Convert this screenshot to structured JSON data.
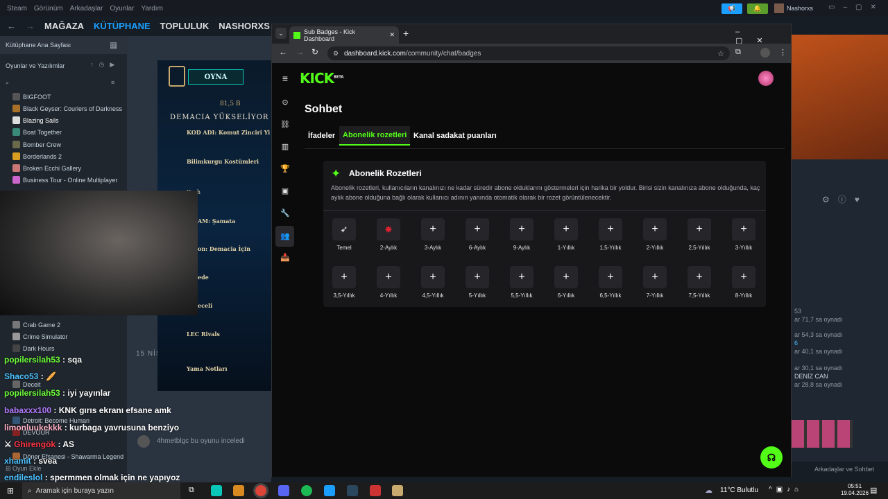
{
  "steam": {
    "menu": [
      "Steam",
      "Görünüm",
      "Arkadaşlar",
      "Oyunlar",
      "Yardım"
    ],
    "nav": [
      "MAĞAZA",
      "KÜTÜPHANE",
      "TOPLULUK",
      "NASHORXS"
    ],
    "username": "Nashorxs",
    "home": "Kütüphane Ana Sayfası",
    "filter": "Oyunlar ve Yazılımlar",
    "games_top": [
      "BIGFOOT",
      "Black Geyser: Couriers of Darkness",
      "Blazing Sails",
      "Boat Together",
      "Bomber Crew",
      "Borderlands 2",
      "Broken Ecchi Gallery",
      "Business Tour - Online Multiplayer"
    ],
    "games_bottom": [
      "Crab Game 2",
      "Crime Simulator",
      "Dark Hours",
      "Deceit",
      "Detroit: Become Human",
      "DEVOUR",
      "Döner Efsanesi - Shawarma Legend"
    ],
    "add_game": "Oyun Ekle",
    "friends_chat": "Arkadaşlar ve Sohbet",
    "date_label": "15 NİS",
    "review_text": "4hmetblgc bu oyunu inceledi",
    "right_stats": [
      "53",
      "ar 71,7 sa oynadı",
      "ar 54,3 sa oynadı",
      "6",
      "ar 40,1 sa oynadı",
      "ar 30,1 sa oynadı",
      "DENİZ CAN",
      "ar 28,8 sa oynadı"
    ]
  },
  "lol": {
    "play": "OYNA",
    "currency": "81,5 B",
    "banner": "DEMACIA YÜKSELİYOR",
    "items": [
      "KOD ADI: Komut Zinciri Yi",
      "Bilimkurgu Kostümleri",
      "Kash",
      "AM: Şamata",
      "on: Demacia İçin",
      "ede",
      "eceli",
      "LEC Rivals",
      "Yama Notları"
    ]
  },
  "chat": [
    {
      "user": "popilersilah53",
      "msg": "sqa",
      "color": "#6dff3a"
    },
    {
      "user": "Shaco53",
      "msg": "🥖",
      "color": "#4cc2ff"
    },
    {
      "user": "popilersilah53",
      "msg": "iyi yayınlar",
      "color": "#6dff3a"
    },
    {
      "user": "babaxxx100",
      "msg": "KNK gırıs ekranı efsane amk",
      "color": "#b47cff"
    },
    {
      "user": "limonluukekkk",
      "msg": "kurbaga yavrusuna benziyo",
      "color": "#ffb3c7"
    },
    {
      "user": "Ghirengök",
      "msg": "AS",
      "color": "#ff3344"
    },
    {
      "user": "xhamit",
      "msg": "svea",
      "color": "#4cc2ff"
    },
    {
      "user": "endileslol",
      "msg": "spermmen olmak için ne yapıyoz",
      "color": "#4cc2ff"
    }
  ],
  "browser": {
    "tab_title": "Sub Badges - Kick Dashboard",
    "url_host": "dashboard.kick.com",
    "url_path": "/community/chat/badges"
  },
  "kick": {
    "logo": "KICK",
    "logo_sup": "BETA",
    "page_title": "Sohbet",
    "tabs": [
      "İfadeler",
      "Abonelik rozetleri",
      "Kanal sadakat puanları"
    ],
    "card_title": "Abonelik Rozetleri",
    "card_desc": "Abonelik rozetleri, kullanıcıların kanalınızı ne kadar süredir abone olduklarını göstermeleri için harika bir yoldur. Birisi sizin kanalınıza abone olduğunda, kaç aylık abone olduğuna bağlı olarak kullanıcı adının yanında otomatik olarak bir rozet görüntülenecektir.",
    "badges_row1": [
      "Temel",
      "2-Aylık",
      "3-Aylık",
      "6-Aylık",
      "9-Aylık",
      "1-Yıllık",
      "1,5-Yıllık",
      "2-Yıllık",
      "2,5-Yıllık",
      "3-Yıllık"
    ],
    "badges_row2": [
      "3,5-Yıllık",
      "4-Yıllık",
      "4,5-Yıllık",
      "5-Yıllık",
      "5,5-Yıllık",
      "6-Yıllık",
      "6,5-Yıllık",
      "7-Yıllık",
      "7,5-Yıllık",
      "8-Yıllık"
    ],
    "add_symbol": "+",
    "accent": "#53fc18"
  },
  "taskbar": {
    "search": "Aramak için buraya yazın",
    "weather": "11°C Bulutlu",
    "time": "05:51",
    "date": "19.04.2026"
  }
}
